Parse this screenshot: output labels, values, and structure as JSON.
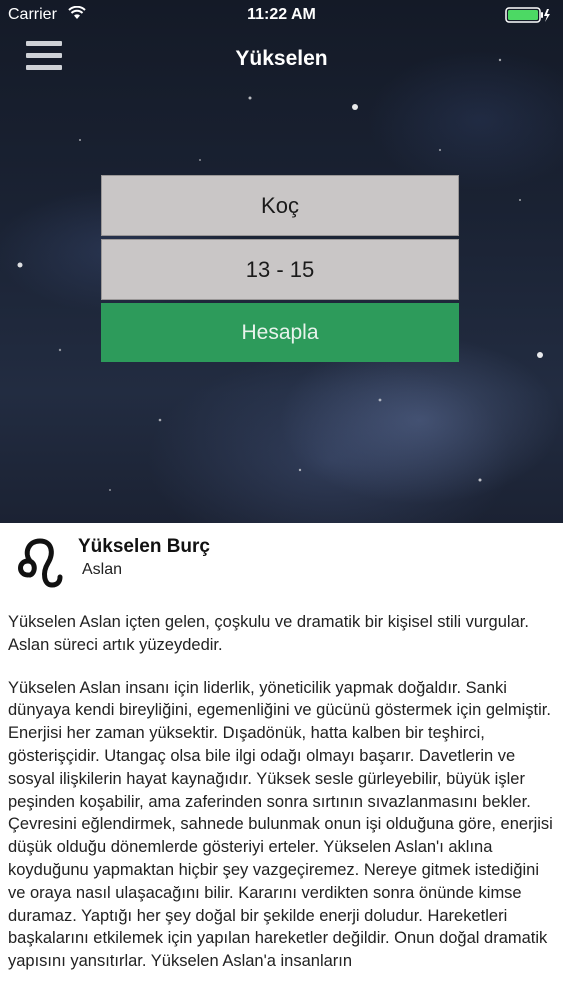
{
  "status_bar": {
    "carrier": "Carrier",
    "time": "11:22 AM"
  },
  "nav": {
    "title": "Yükselen",
    "menu_icon": "hamburger-menu-icon"
  },
  "form": {
    "sign_value": "Koç",
    "hour_value": "13 - 15",
    "calculate_label": "Hesapla",
    "calculate_color": "#2d9b5b"
  },
  "result": {
    "icon": "leo-sign-icon",
    "title": "Yükselen Burç",
    "sign": "Aslan",
    "paragraphs": [
      "Yükselen Aslan içten gelen, çoşkulu ve dramatik bir kişisel stili vurgular. Aslan süreci artık yüzeydedir.",
      "Yükselen Aslan insanı için liderlik, yöneticilik yapmak doğaldır. Sanki dünyaya kendi bireyliğini, egemenliğini ve gücünü göstermek için gelmiştir. Enerjisi her zaman yüksektir. Dışadönük, hatta kalben bir teşhirci,  gösterişçidir. Utangaç olsa bile ilgi odağı olmayı başarır. Davetlerin ve sosyal ilişkilerin hayat kaynağıdır. Yüksek sesle gürleyebilir, büyük işler peşinden koşabilir, ama zaferinden sonra sırtının sıvazlanmasını bekler. Çevresini eğlendirmek, sahnede bulunmak onun işi olduğuna göre, enerjisi düşük olduğu dönemlerde gösteriyi erteler. Yükselen Aslan'ı aklına koyduğunu yapmaktan hiçbir şey vazgeçiremez. Nereye gitmek istediğini ve oraya nasıl ulaşacağını bilir. Kararını verdikten sonra önünde kimse duramaz. Yaptığı her şey doğal bir şekilde enerji doludur. Hareketleri başkalarını etkilemek için yapılan hareketler değildir. Onun doğal dramatik yapısını yansıtırlar. Yükselen Aslan'a insanların"
    ]
  }
}
